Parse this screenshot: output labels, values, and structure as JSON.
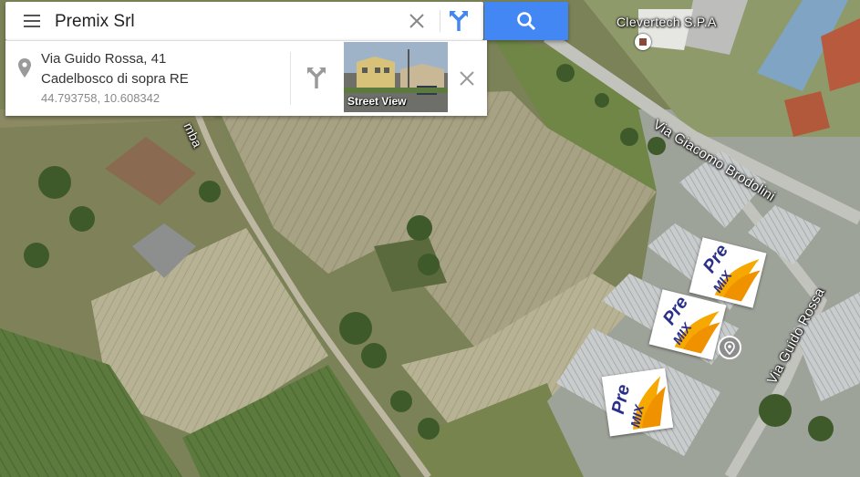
{
  "search": {
    "query": "Premix Srl"
  },
  "place": {
    "address": "Via Guido Rossa, 41",
    "locality": "Cadelbosco di sopra RE",
    "coordinates": "44.793758, 10.608342",
    "street_view_label": "Street View"
  },
  "map_labels": {
    "poi_name": "Clevertech S.P.A",
    "road_1": "Via Giacomo Brodolini",
    "road_2": "Via Guido Rossa",
    "road_fragment": "mba"
  },
  "logos": {
    "pre": "Pre",
    "mix": "MIX"
  },
  "colors": {
    "search_button": "#4387f5",
    "directions_blue": "#4387f5",
    "logo_text": "#2a2f8a",
    "logo_flame": "#f6a800"
  },
  "icons": [
    "menu-icon",
    "clear-icon",
    "directions-icon",
    "search-icon",
    "location-pin-icon",
    "close-icon"
  ]
}
